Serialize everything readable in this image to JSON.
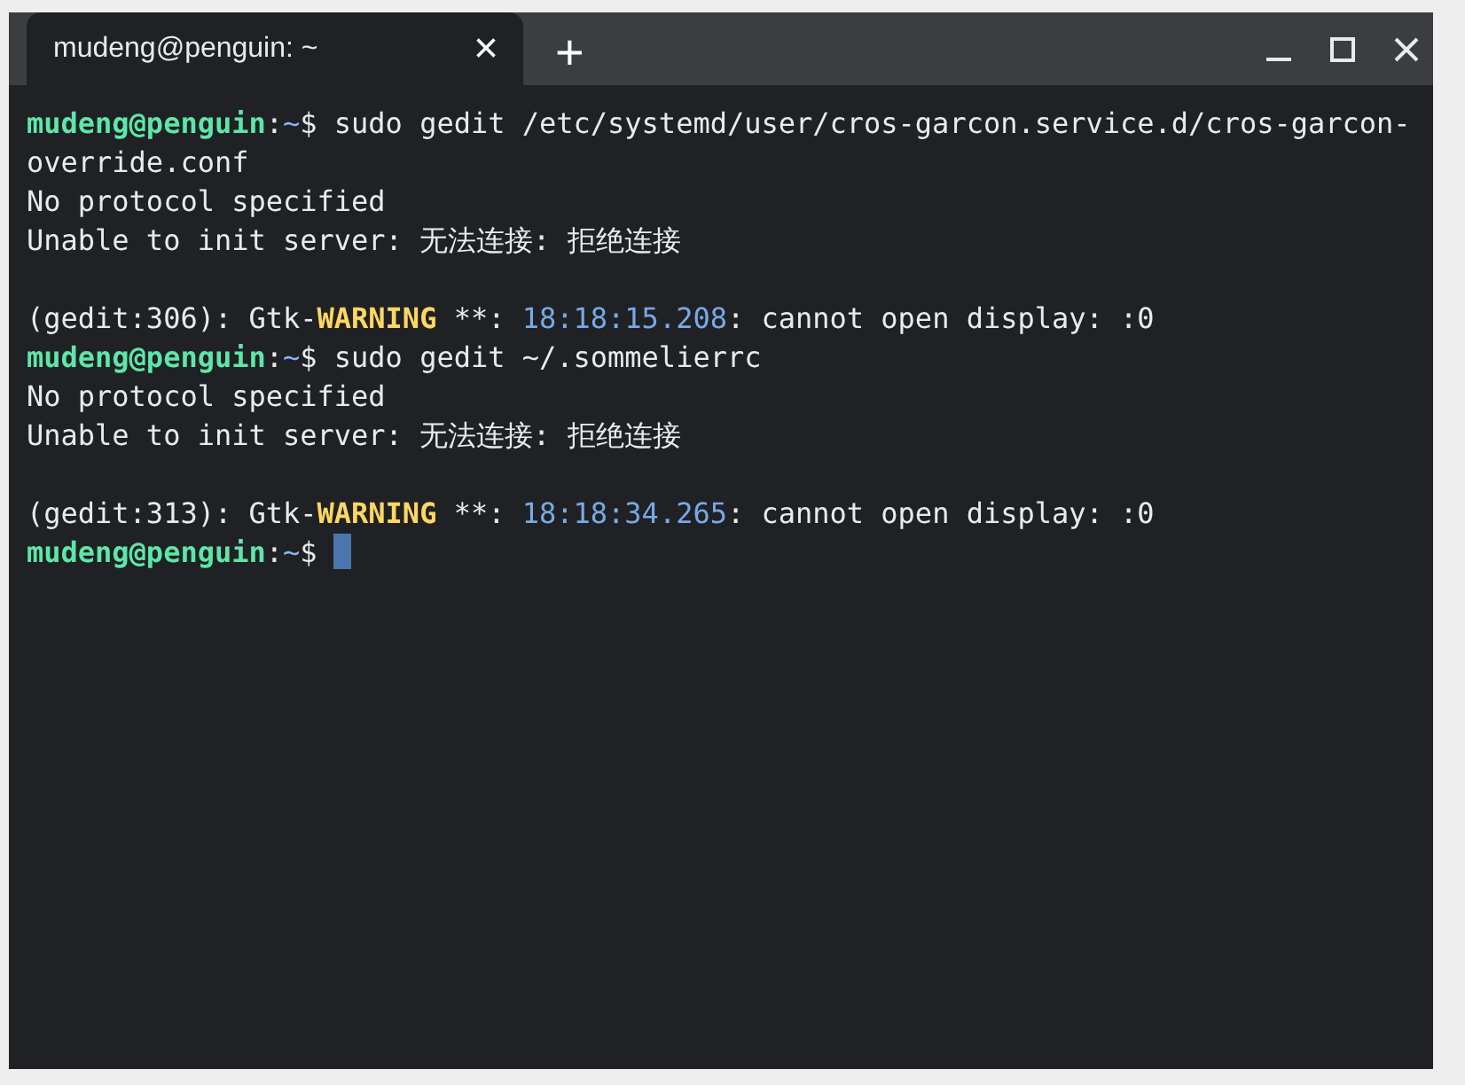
{
  "tabs": [
    {
      "title": "mudeng@penguin: ~",
      "close": "×",
      "selected": true
    }
  ],
  "new_tab": "+",
  "lines": [
    {
      "kind": "text",
      "segments": [
        {
          "kind": "user",
          "text": "mudeng@penguin"
        },
        {
          "kind": "plain",
          "text": ":"
        },
        {
          "kind": "path",
          "text": "~"
        },
        {
          "kind": "plain",
          "text": "$ sudo gedit /etc/systemd/user/cros-garcon.service.d/cros-garcon-"
        }
      ]
    },
    {
      "kind": "text",
      "segments": [
        {
          "kind": "plain",
          "text": "override.conf"
        }
      ]
    },
    {
      "kind": "text",
      "segments": [
        {
          "kind": "plain",
          "text": "No protocol specified"
        }
      ]
    },
    {
      "kind": "text",
      "segments": [
        {
          "kind": "plain",
          "text": "Unable to init server: 无法连接: 拒绝连接"
        }
      ]
    },
    {
      "kind": "blank"
    },
    {
      "kind": "text",
      "segments": [
        {
          "kind": "plain",
          "text": "(gedit:306): Gtk-"
        },
        {
          "kind": "warning",
          "text": "WARNING"
        },
        {
          "kind": "plain",
          "text": " **: "
        },
        {
          "kind": "time",
          "text": "18:18:15.208"
        },
        {
          "kind": "plain",
          "text": ": cannot open display: :0"
        }
      ]
    },
    {
      "kind": "text",
      "segments": [
        {
          "kind": "user",
          "text": "mudeng@penguin"
        },
        {
          "kind": "plain",
          "text": ":"
        },
        {
          "kind": "path",
          "text": "~"
        },
        {
          "kind": "plain",
          "text": "$ sudo gedit ~/.sommelierrc"
        }
      ]
    },
    {
      "kind": "text",
      "segments": [
        {
          "kind": "plain",
          "text": "No protocol specified"
        }
      ]
    },
    {
      "kind": "text",
      "segments": [
        {
          "kind": "plain",
          "text": "Unable to init server: 无法连接: 拒绝连接"
        }
      ]
    },
    {
      "kind": "blank"
    },
    {
      "kind": "text",
      "segments": [
        {
          "kind": "plain",
          "text": "(gedit:313): Gtk-"
        },
        {
          "kind": "warning",
          "text": "WARNING"
        },
        {
          "kind": "plain",
          "text": " **: "
        },
        {
          "kind": "time",
          "text": "18:18:34.265"
        },
        {
          "kind": "plain",
          "text": ": cannot open display: :0"
        }
      ]
    },
    {
      "kind": "text",
      "segments": [
        {
          "kind": "user",
          "text": "mudeng@penguin"
        },
        {
          "kind": "plain",
          "text": ":"
        },
        {
          "kind": "path",
          "text": "~"
        },
        {
          "kind": "plain",
          "text": "$ "
        }
      ],
      "cursor": true
    }
  ]
}
